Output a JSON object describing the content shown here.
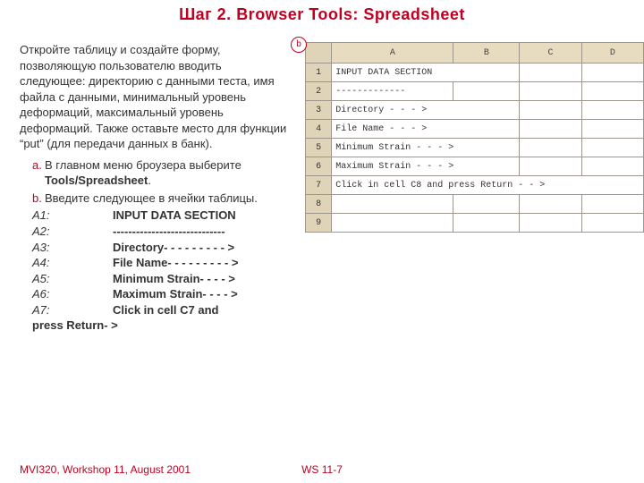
{
  "title": "Шаг 2.  Browser Tools:  Spreadsheet",
  "intro": "Откройте таблицу и создайте форму, позволяющую пользователю вводить следующее: директорию с данными теста, имя файла с данными, минимальный уровень деформаций, максимальный уровень деформаций. Также оставьте место для функции “put” (для передачи данных в банк).",
  "step_a_label": "a.",
  "step_a_pre": "В главном меню броузера выберите ",
  "step_a_bold": "Tools/Spreadsheet",
  "step_a_post": ".",
  "step_b_label": "b.",
  "step_b_text": "Введите следующее в ячейки таблицы.",
  "cells": [
    {
      "ref": "A1:",
      "val": "INPUT DATA SECTION"
    },
    {
      "ref": "A2:",
      "val": "-----------------------------"
    },
    {
      "ref": "A3:",
      "val": "Directory- - - - - - - - - >"
    },
    {
      "ref": "A4:",
      "val": "File Name- - - - - - - - - >"
    },
    {
      "ref": "A5:",
      "val": "Minimum Strain- - - - >"
    },
    {
      "ref": "A6:",
      "val": "Maximum Strain- - - - >"
    },
    {
      "ref": "A7:",
      "val": "Click in cell C7 and"
    }
  ],
  "last_line": "press Return- >",
  "sheet": {
    "cols": [
      "A",
      "B",
      "C",
      "D"
    ],
    "rows": [
      {
        "n": "1",
        "a": "INPUT DATA SECTION"
      },
      {
        "n": "2",
        "a": "-------------"
      },
      {
        "n": "3",
        "a": "Directory - - - >"
      },
      {
        "n": "4",
        "a": "File Name - - - >"
      },
      {
        "n": "5",
        "a": "Minimum Strain - - - >"
      },
      {
        "n": "6",
        "a": "Maximum Strain - - - >"
      },
      {
        "n": "7",
        "a": "Click in cell C8 and press Return - - >"
      },
      {
        "n": "8",
        "a": ""
      },
      {
        "n": "9",
        "a": ""
      }
    ]
  },
  "callout": "b",
  "footer_left": "MVI320, Workshop 11, August 2001",
  "footer_center": "WS 11-7"
}
